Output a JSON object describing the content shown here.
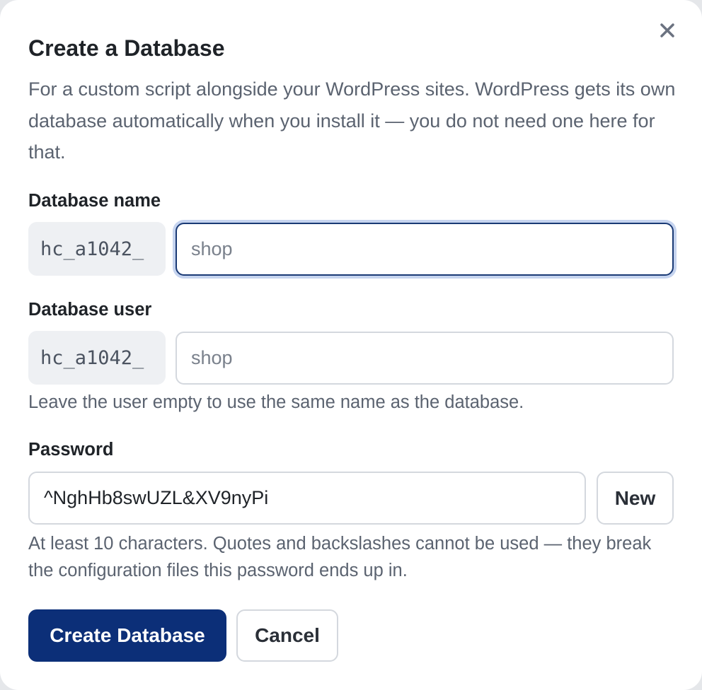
{
  "dialog": {
    "title": "Create a Database",
    "intro": "For a custom script alongside your WordPress sites. WordPress gets its own database automatically when you install it — you do not need one here for that.",
    "close_icon": "close-icon"
  },
  "db_name": {
    "label": "Database name",
    "prefix": "hc_a1042_",
    "value": "",
    "placeholder": "shop"
  },
  "db_user": {
    "label": "Database user",
    "prefix": "hc_a1042_",
    "value": "",
    "placeholder": "shop",
    "hint": "Leave the user empty to use the same name as the database."
  },
  "password": {
    "label": "Password",
    "value": "^NghHb8swUZL&XV9nyPi",
    "new_label": "New",
    "hint": "At least 10 characters. Quotes and backslashes cannot be used — they break the configuration files this password ends up in."
  },
  "actions": {
    "create_label": "Create Database",
    "cancel_label": "Cancel"
  },
  "colors": {
    "primary": "#0c2f78",
    "focus_ring": "#c6d4ef",
    "prefix_bg": "#eef0f3"
  }
}
